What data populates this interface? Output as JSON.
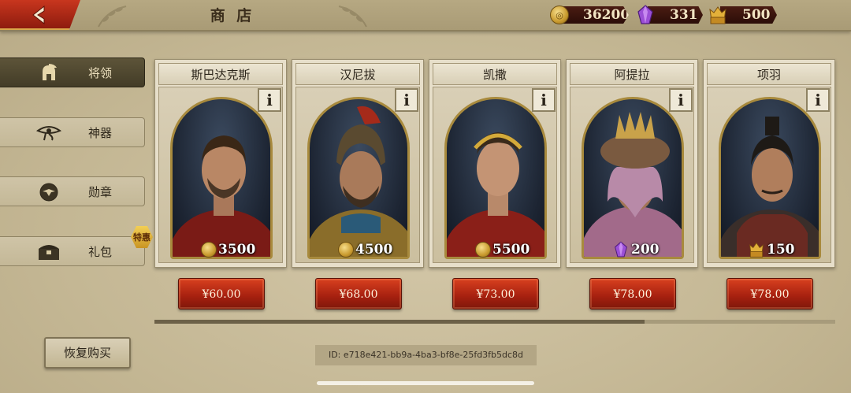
{
  "header": {
    "title": "商 店",
    "resources": [
      {
        "icon": "gold-coin-icon",
        "value": "36200"
      },
      {
        "icon": "purple-gem-icon",
        "value": "331"
      },
      {
        "icon": "chest-token-icon",
        "value": "500"
      }
    ]
  },
  "sidebar": {
    "items": [
      {
        "label": "将领",
        "icon": "spartan-helmet-icon",
        "active": true
      },
      {
        "label": "神器",
        "icon": "eye-of-horus-icon",
        "active": false
      },
      {
        "label": "勋章",
        "icon": "eagle-medal-icon",
        "active": false
      },
      {
        "label": "礼包",
        "icon": "treasure-chest-icon",
        "active": false
      }
    ],
    "badge": "特惠"
  },
  "cards": [
    {
      "name": "斯巴达克斯",
      "currency": "gold-coin-icon",
      "cost": "3500",
      "price": "¥60.00"
    },
    {
      "name": "汉尼拔",
      "currency": "gold-coin-icon",
      "cost": "4500",
      "price": "¥68.00"
    },
    {
      "name": "凯撒",
      "currency": "gold-coin-icon",
      "cost": "5500",
      "price": "¥73.00"
    },
    {
      "name": "阿提拉",
      "currency": "purple-gem-icon",
      "cost": "200",
      "price": "¥78.00"
    },
    {
      "name": "项羽",
      "currency": "chest-token-icon",
      "cost": "150",
      "price": "¥78.00"
    }
  ],
  "info_label": "i",
  "scroll": {
    "visible_fraction": 0.72
  },
  "footer": {
    "restore_label": "恢复购买",
    "id_text": "ID: e718e421-bb9a-4ba3-bf8e-25fd3fb5dc8d"
  },
  "colors": {
    "accent_red": "#b52a14",
    "background": "#c9bc9c",
    "active_tab": "#4e4630"
  }
}
